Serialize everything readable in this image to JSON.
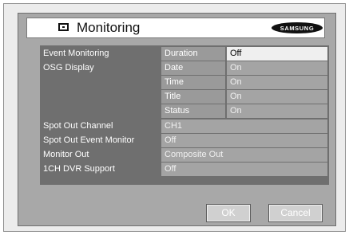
{
  "header": {
    "title": "Monitoring",
    "brand": "SAMSUNG"
  },
  "rows": {
    "event_monitoring": {
      "label": "Event Monitoring",
      "sub": "Duration",
      "value": "Off"
    },
    "osg_display": {
      "label": "OSG Display",
      "subs": [
        {
          "sub": "Date",
          "value": "On"
        },
        {
          "sub": "Time",
          "value": "On"
        },
        {
          "sub": "Title",
          "value": "On"
        },
        {
          "sub": "Status",
          "value": "On"
        }
      ]
    },
    "spot_out_channel": {
      "label": "Spot Out Channel",
      "value": "CH1"
    },
    "spot_out_event_monitor": {
      "label": "Spot Out Event Monitor",
      "value": "Off"
    },
    "monitor_out": {
      "label": "Monitor Out",
      "value": "Composite Out"
    },
    "dvr_support": {
      "label": "1CH DVR Support",
      "value": "Off"
    }
  },
  "buttons": {
    "ok": "OK",
    "cancel": "Cancel"
  },
  "colors": {
    "panel": "#a8a8a8",
    "label_bg": "#6f6f6f",
    "value_bg": "#a4a4a4",
    "selected_bg": "#efefef"
  },
  "icons": {
    "title_icon": "monitor-icon"
  }
}
